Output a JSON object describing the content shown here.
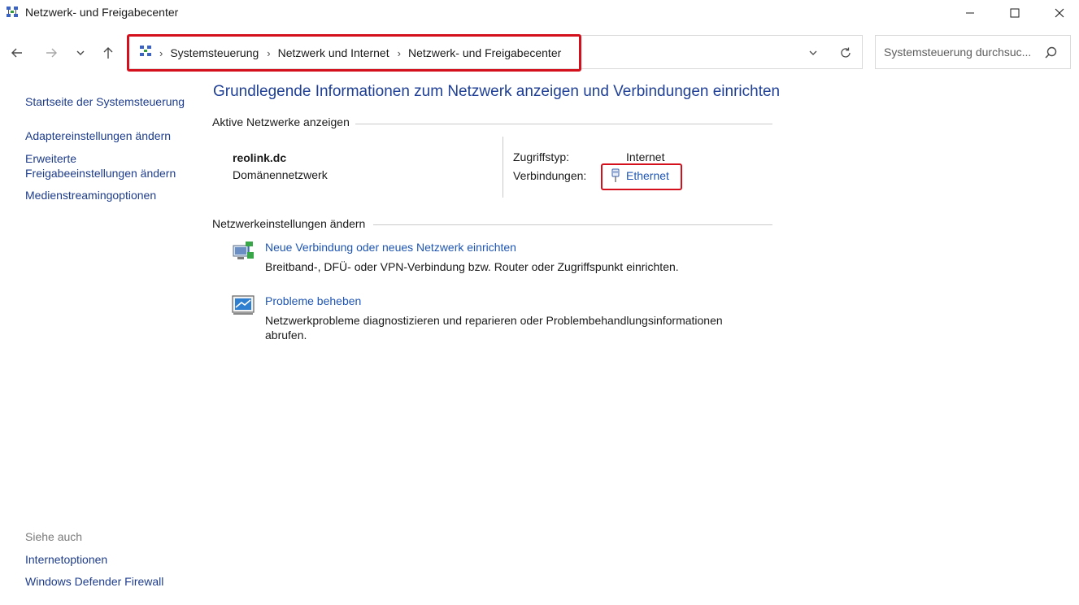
{
  "window": {
    "title": "Netzwerk- und Freigabecenter",
    "icon": "network-center-icon"
  },
  "navigation": {
    "breadcrumb": [
      "Systemsteuerung",
      "Netzwerk und Internet",
      "Netzwerk- und Freigabecenter"
    ],
    "search_placeholder": "Systemsteuerung durchsuc..."
  },
  "sidebar": {
    "home": "Startseite der Systemsteuerung",
    "adapter": "Adaptereinstellungen ändern",
    "sharing_line1": "Erweiterte",
    "sharing_line2": "Freigabeeinstellungen ändern",
    "media": "Medienstreamingoptionen",
    "see_also": "Siehe auch",
    "internet_options": "Internetoptionen",
    "firewall": "Windows Defender Firewall"
  },
  "main": {
    "title": "Grundlegende Informationen zum Netzwerk anzeigen und Verbindungen einrichten",
    "active_section": "Aktive Netzwerke anzeigen",
    "network": {
      "name": "reolink.dc",
      "type": "Domänennetzwerk",
      "access_label": "Zugriffstyp:",
      "access_value": "Internet",
      "connections_label": "Verbindungen:",
      "connection": "Ethernet"
    },
    "settings_section": "Netzwerkeinstellungen ändern",
    "tasks": [
      {
        "title": "Neue Verbindung oder neues Netzwerk einrichten",
        "desc": "Breitband-, DFÜ- oder VPN-Verbindung bzw. Router oder Zugriffspunkt einrichten."
      },
      {
        "title": "Probleme beheben",
        "desc": "Netzwerkprobleme diagnostizieren und reparieren oder Problembehandlungsinformationen abrufen."
      }
    ]
  },
  "colors": {
    "highlight": "#d3101c",
    "link": "#1e55b3",
    "title": "#1e3f95"
  }
}
